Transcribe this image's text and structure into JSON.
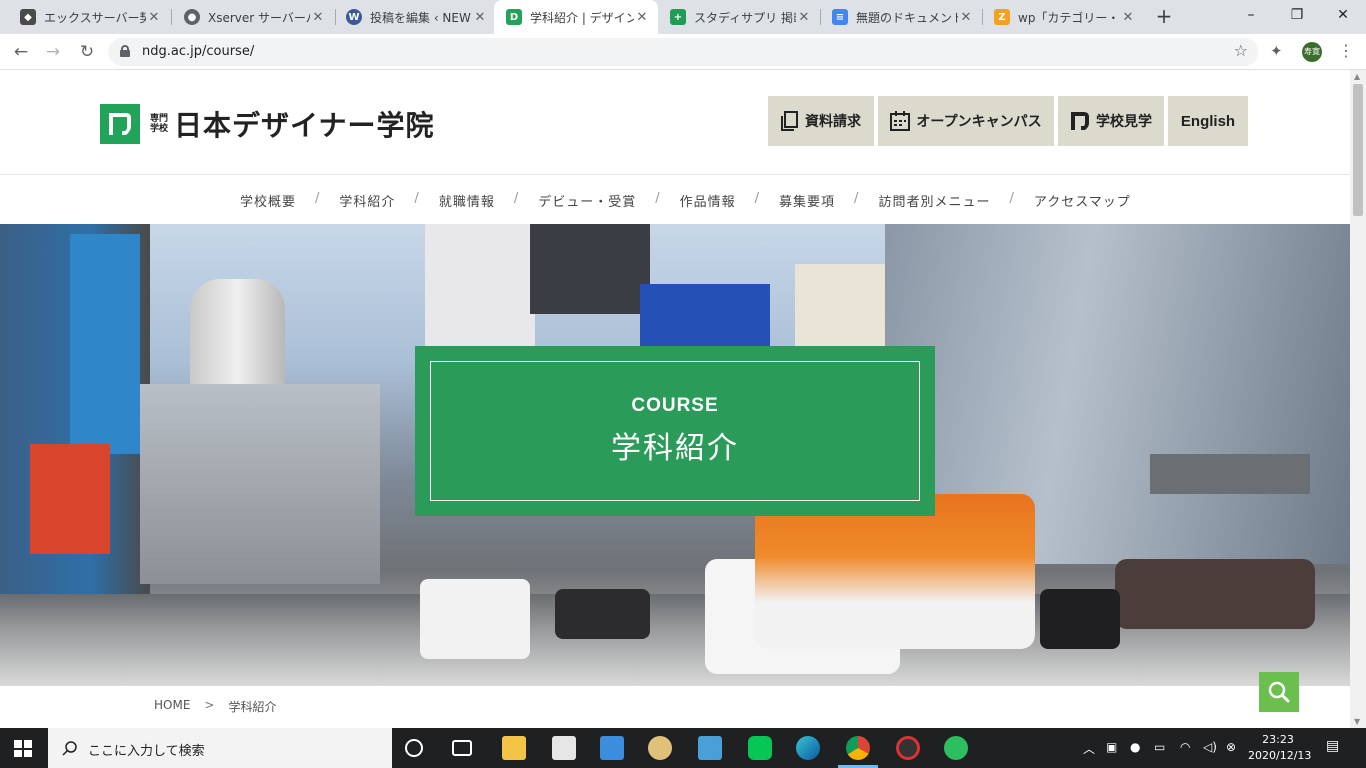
{
  "browser": {
    "tabs": [
      {
        "title": "エックスサーバー契約中",
        "active": false,
        "favicon_color": "#4a4a4a"
      },
      {
        "title": "Xserver サーバーパネル",
        "active": false,
        "favicon_color": "#5f6368"
      },
      {
        "title": "投稿を編集 ‹ NEW",
        "active": false,
        "favicon_color": "#3c5a99"
      },
      {
        "title": "学科紹介 | デザイン",
        "active": true,
        "favicon_color": "#22a35a"
      },
      {
        "title": "スタディサプリ 掲載",
        "active": false,
        "favicon_color": "#1f9d55"
      },
      {
        "title": "無題のドキュメント -",
        "active": false,
        "favicon_color": "#4285f4"
      },
      {
        "title": "wp「カテゴリー・タグを",
        "active": false,
        "favicon_color": "#f4a11d"
      }
    ],
    "url": "ndg.ac.jp/course/",
    "profile_label": "寿寛"
  },
  "site": {
    "logo": {
      "small": "専門学校",
      "name": "日本デザイナー学院"
    },
    "header_buttons": [
      {
        "label": "資料請求",
        "icon": "document-icon"
      },
      {
        "label": "オープンキャンパス",
        "icon": "calendar-icon"
      },
      {
        "label": "学校見学",
        "icon": "school-logo-icon"
      },
      {
        "label": "English",
        "icon": ""
      }
    ],
    "nav": [
      "学校概要",
      "学科紹介",
      "就職情報",
      "デビュー・受賞",
      "作品情報",
      "募集要項",
      "訪問者別メニュー",
      "アクセスマップ"
    ],
    "nav_separator": "/",
    "hero": {
      "title_en": "COURSE",
      "title_jp": "学科紹介"
    },
    "breadcrumb": {
      "home": "HOME",
      "separator": ">",
      "current": "学科紹介"
    },
    "accent_color": "#2a9b58",
    "fab_color": "#6bbf4e"
  },
  "taskbar": {
    "search_placeholder": "ここに入力して検索",
    "time": "23:23",
    "date": "2020/12/13"
  }
}
